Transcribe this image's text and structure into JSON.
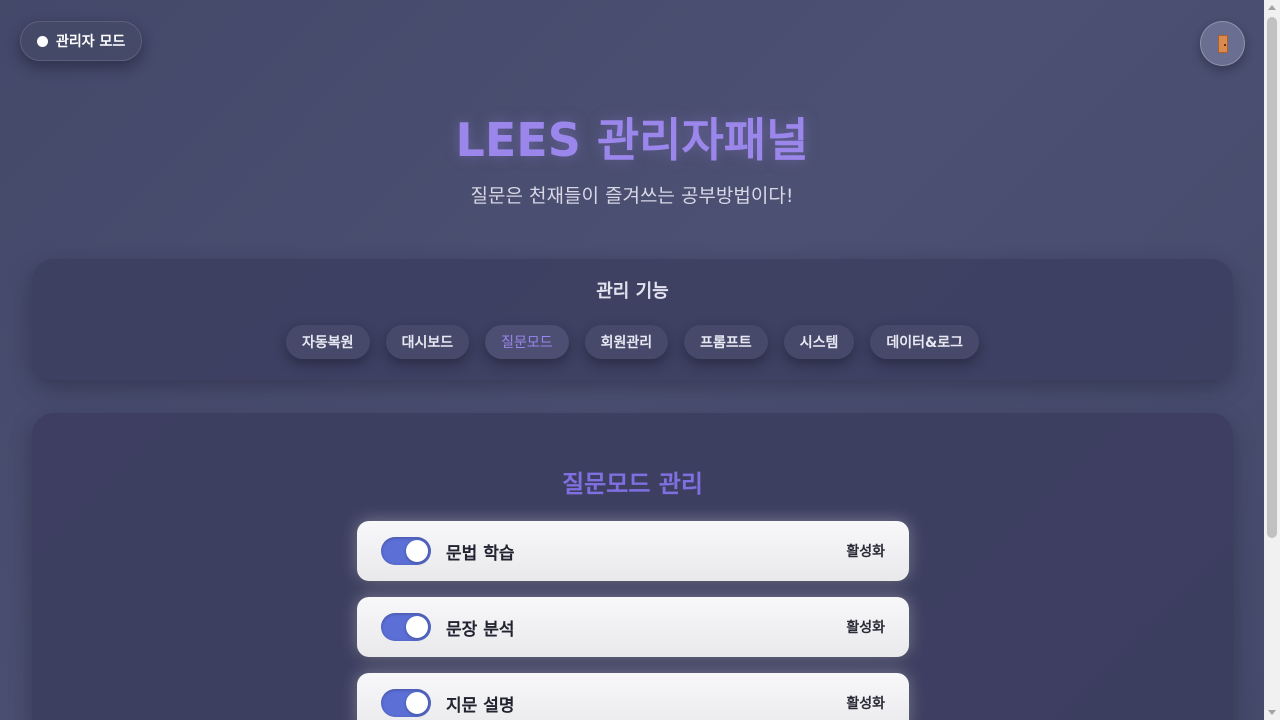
{
  "admin_mode": {
    "label": "관리자 모드",
    "icon": "status-dot-icon"
  },
  "logout": {
    "icon": "door-icon",
    "accent": "#d98a4e"
  },
  "header": {
    "title": "LEES 관리자패널",
    "subtitle": "질문은 천재들이 즐겨쓰는 공부방법이다!"
  },
  "functions": {
    "title": "관리 기능",
    "tabs": [
      {
        "label": "자동복원",
        "active": false
      },
      {
        "label": "대시보드",
        "active": false
      },
      {
        "label": "질문모드",
        "active": true
      },
      {
        "label": "회원관리",
        "active": false
      },
      {
        "label": "프롬프트",
        "active": false
      },
      {
        "label": "시스템",
        "active": false
      },
      {
        "label": "데이터&로그",
        "active": false
      }
    ]
  },
  "question_mode": {
    "title": "질문모드 관리",
    "modes": [
      {
        "label": "문법 학습",
        "status": "활성화",
        "enabled": true
      },
      {
        "label": "문장 분석",
        "status": "활성화",
        "enabled": true
      },
      {
        "label": "지문 설명",
        "status": "활성화",
        "enabled": true
      }
    ]
  },
  "colors": {
    "accent": "#9b86ec",
    "section_title": "#7f6fe0",
    "toggle_on": "#5b6fd6",
    "background": "#4a4e70"
  }
}
